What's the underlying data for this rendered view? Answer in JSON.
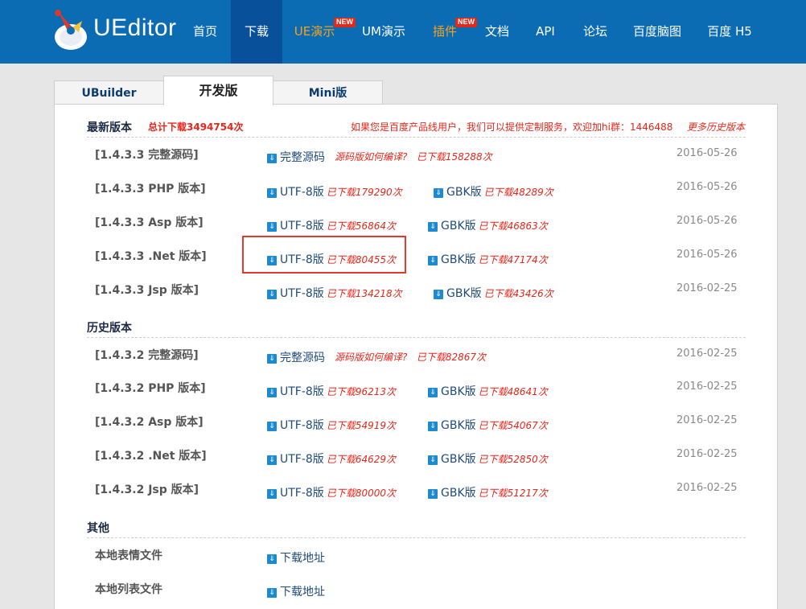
{
  "brand": {
    "name": "UEditor"
  },
  "nav": {
    "items": [
      {
        "label": "首页",
        "active": false,
        "badge": ""
      },
      {
        "label": "下载",
        "active": true,
        "badge": ""
      },
      {
        "label": "UE演示",
        "active": false,
        "badge": "NEW"
      },
      {
        "label": "UM演示",
        "active": false,
        "badge": ""
      },
      {
        "label": "插件",
        "active": false,
        "badge": "NEW"
      },
      {
        "label": "文档",
        "active": false,
        "badge": ""
      },
      {
        "label": "API",
        "active": false,
        "badge": ""
      },
      {
        "label": "论坛",
        "active": false,
        "badge": ""
      },
      {
        "label": "百度脑图",
        "active": false,
        "badge": ""
      },
      {
        "label": "百度 H5",
        "active": false,
        "badge": ""
      }
    ]
  },
  "tabs": [
    {
      "label": "UBuilder",
      "active": false
    },
    {
      "label": "开发版",
      "active": true
    },
    {
      "label": "Mini版",
      "active": false
    }
  ],
  "latest": {
    "title": "最新版本",
    "total": "总计下载3494754次",
    "notice": "如果您是百度产品线用户，我们可以提供定制服务，欢迎加hi群：1446488",
    "more": "更多历史版本",
    "rows": [
      {
        "name": "[1.4.3.3 完整源码]",
        "primary": "完整源码",
        "primary_count": "",
        "howto": "源码版如何编译?",
        "howto_count": "已下载158288次",
        "secondary": "",
        "secondary_count": "",
        "date": "2016-05-26"
      },
      {
        "name": "[1.4.3.3 PHP 版本]",
        "primary": "UTF-8版",
        "primary_count": "已下载179290次",
        "howto": "",
        "howto_count": "",
        "secondary": "GBK版",
        "secondary_count": "已下载48289次",
        "date": "2016-05-26"
      },
      {
        "name": "[1.4.3.3 Asp 版本]",
        "primary": "UTF-8版",
        "primary_count": "已下载56864次",
        "howto": "",
        "howto_count": "",
        "secondary": "GBK版",
        "secondary_count": "已下载46863次",
        "date": "2016-05-26"
      },
      {
        "name": "[1.4.3.3 .Net 版本]",
        "primary": "UTF-8版",
        "primary_count": "已下载80455次",
        "howto": "",
        "howto_count": "",
        "secondary": "GBK版",
        "secondary_count": "已下载47174次",
        "date": "2016-05-26"
      },
      {
        "name": "[1.4.3.3 Jsp 版本]",
        "primary": "UTF-8版",
        "primary_count": "已下载134218次",
        "howto": "",
        "howto_count": "",
        "secondary": "GBK版",
        "secondary_count": "已下载43426次",
        "date": "2016-02-25"
      }
    ]
  },
  "history": {
    "title": "历史版本",
    "rows": [
      {
        "name": "[1.4.3.2 完整源码]",
        "primary": "完整源码",
        "primary_count": "",
        "howto": "源码版如何编译?",
        "howto_count": "已下载82867次",
        "secondary": "",
        "secondary_count": "",
        "date": "2016-02-25"
      },
      {
        "name": "[1.4.3.2 PHP 版本]",
        "primary": "UTF-8版",
        "primary_count": "已下载96213次",
        "howto": "",
        "howto_count": "",
        "secondary": "GBK版",
        "secondary_count": "已下载48641次",
        "date": "2016-02-25"
      },
      {
        "name": "[1.4.3.2 Asp 版本]",
        "primary": "UTF-8版",
        "primary_count": "已下载54919次",
        "howto": "",
        "howto_count": "",
        "secondary": "GBK版",
        "secondary_count": "已下载54067次",
        "date": "2016-02-25"
      },
      {
        "name": "[1.4.3.2 .Net 版本]",
        "primary": "UTF-8版",
        "primary_count": "已下载64629次",
        "howto": "",
        "howto_count": "",
        "secondary": "GBK版",
        "secondary_count": "已下载52850次",
        "date": "2016-02-25"
      },
      {
        "name": "[1.4.3.2 Jsp 版本]",
        "primary": "UTF-8版",
        "primary_count": "已下载80000次",
        "howto": "",
        "howto_count": "",
        "secondary": "GBK版",
        "secondary_count": "已下载51217次",
        "date": "2016-02-25"
      }
    ]
  },
  "other": {
    "title": "其他",
    "rows": [
      {
        "name": "本地表情文件",
        "link": "下载地址"
      },
      {
        "name": "本地列表文件",
        "link": "下载地址"
      }
    ]
  },
  "colors": {
    "header": "#0b6cb4",
    "nav_active": "#08509a",
    "accent_red": "#e8261a",
    "link_blue": "#1f4b7b",
    "highlight": "#e23b2e"
  }
}
